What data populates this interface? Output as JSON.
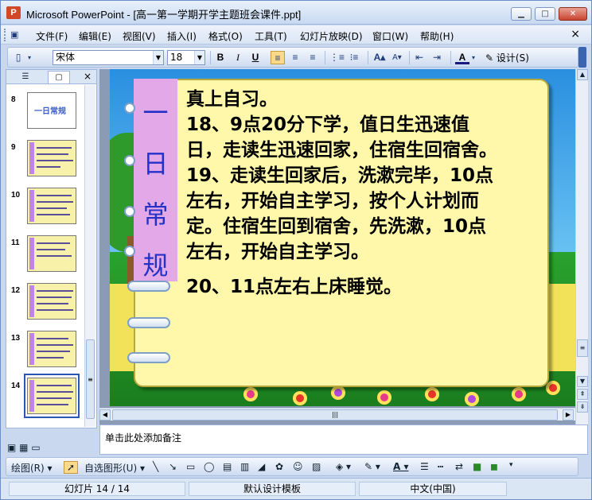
{
  "window": {
    "title": "Microsoft PowerPoint - [高一第一学期开学主题班会课件.ppt]",
    "app_icon": "P",
    "controls": {
      "minimize": "▁",
      "maximize": "□",
      "close": "✕"
    }
  },
  "menu": {
    "items": [
      "文件(F)",
      "编辑(E)",
      "视图(V)",
      "插入(I)",
      "格式(O)",
      "工具(T)",
      "幻灯片放映(D)",
      "窗口(W)",
      "帮助(H)"
    ],
    "close": "×"
  },
  "toolbar": {
    "font_name": "宋体",
    "font_size": "18",
    "bold": "B",
    "italic": "I",
    "underline": "U",
    "design_label": "设计(S)"
  },
  "thumbnails": {
    "tabs": {
      "outline": "☰",
      "slides": "▢"
    },
    "close": "×",
    "items": [
      {
        "num": "8",
        "title": "一日常规"
      },
      {
        "num": "9"
      },
      {
        "num": "10"
      },
      {
        "num": "11"
      },
      {
        "num": "12"
      },
      {
        "num": "13"
      },
      {
        "num": "14"
      }
    ],
    "selected": "14"
  },
  "slide": {
    "ribbon_chars": [
      "一",
      "日",
      "常",
      "规"
    ],
    "lines": [
      "真上自习。",
      "18、9点20分下学，值日生迅速值",
      "日，走读生迅速回家，住宿生回宿舍。",
      "19、走读生回家后，洗漱完毕，10点",
      "左右，开始自主学习，按个人计划而",
      "定。住宿生回到宿舍，先洗漱，10点",
      "左右，开始自主学习。",
      "20、11点左右上床睡觉。"
    ]
  },
  "notes": {
    "placeholder": "单击此处添加备注"
  },
  "drawing": {
    "draw_label": "绘图(R)",
    "autoshape_label": "自选图形(U)"
  },
  "status": {
    "slide_label": "幻灯片 14 / 14",
    "template": "默认设计模板",
    "language": "中文(中国)"
  }
}
